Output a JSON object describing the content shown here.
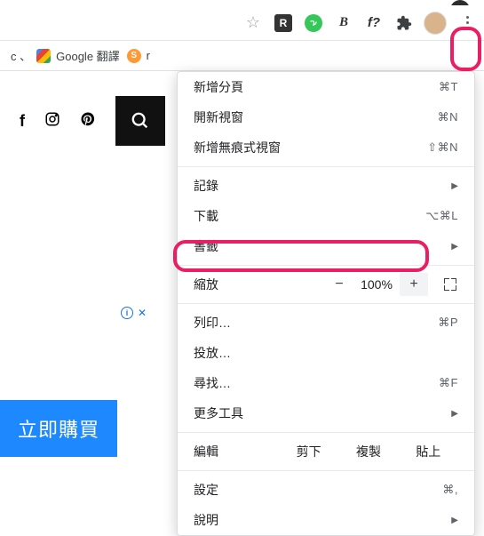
{
  "topbar": {
    "r_badge": "R",
    "bold_b": "B",
    "fq": "f?"
  },
  "bookmarks": {
    "item1_prefix": "c 、",
    "item1_label": "Google 翻譯",
    "item2_label": "r"
  },
  "page": {
    "ad_close": "✕",
    "cta_label": "立即購買"
  },
  "menu": {
    "new_tab": {
      "label": "新增分頁",
      "shortcut": "⌘T"
    },
    "new_window": {
      "label": "開新視窗",
      "shortcut": "⌘N"
    },
    "incognito": {
      "label": "新增無痕式視窗",
      "shortcut": "⇧⌘N"
    },
    "history": {
      "label": "記錄"
    },
    "downloads": {
      "label": "下載",
      "shortcut": "⌥⌘L"
    },
    "bookmarks": {
      "label": "書籤"
    },
    "zoom": {
      "label": "縮放",
      "value": "100%"
    },
    "print": {
      "label": "列印…",
      "shortcut": "⌘P"
    },
    "cast": {
      "label": "投放…"
    },
    "find": {
      "label": "尋找…",
      "shortcut": "⌘F"
    },
    "more_tools": {
      "label": "更多工具"
    },
    "edit": {
      "label": "編輯",
      "cut": "剪下",
      "copy": "複製",
      "paste": "貼上"
    },
    "settings": {
      "label": "設定",
      "shortcut": "⌘,"
    },
    "help": {
      "label": "說明"
    }
  }
}
